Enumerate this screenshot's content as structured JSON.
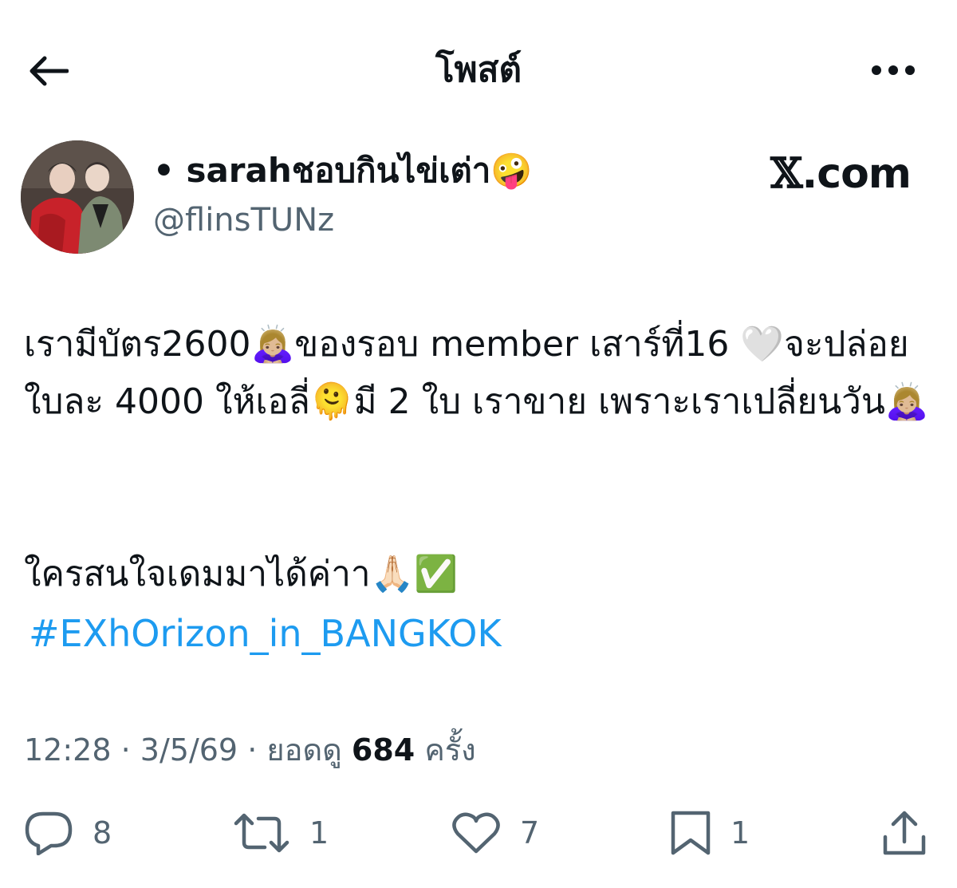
{
  "header": {
    "title": "โพสต์",
    "back_icon": "arrow-left-icon",
    "more_icon": "more-horizontal-icon"
  },
  "author": {
    "display_name": "• sarahชอบกินไข่เต่า🤪",
    "handle": "@flinsTUNz"
  },
  "watermark": {
    "mark": "𝕏",
    "text": ".com"
  },
  "tweet": {
    "paragraph1": "เรามีบัตร2600🙇🏼‍♀️ของรอบ member เสาร์ที่16 🤍จะปล่อยใบละ 4000 ให้เอลี่🫠มี 2 ใบ เราขาย เพราะเราเปลี่ยนวัน🙇🏼‍♀️",
    "line2": "ใครสนใจเดมมาได้ค่าา🙏🏻✅",
    "hashtag": "#EXhOrizon_in_BANGKOK"
  },
  "meta": {
    "time": "12:28",
    "date": "3/5/69",
    "views_label": "ยอดดู",
    "views_count": "684",
    "views_suffix": "ครั้ง"
  },
  "actions": {
    "reply_count": "8",
    "retweet_count": "1",
    "like_count": "7",
    "bookmark_count": "1"
  },
  "colors": {
    "text": "#0f1419",
    "secondary": "#536471",
    "link": "#1d9bf0"
  }
}
